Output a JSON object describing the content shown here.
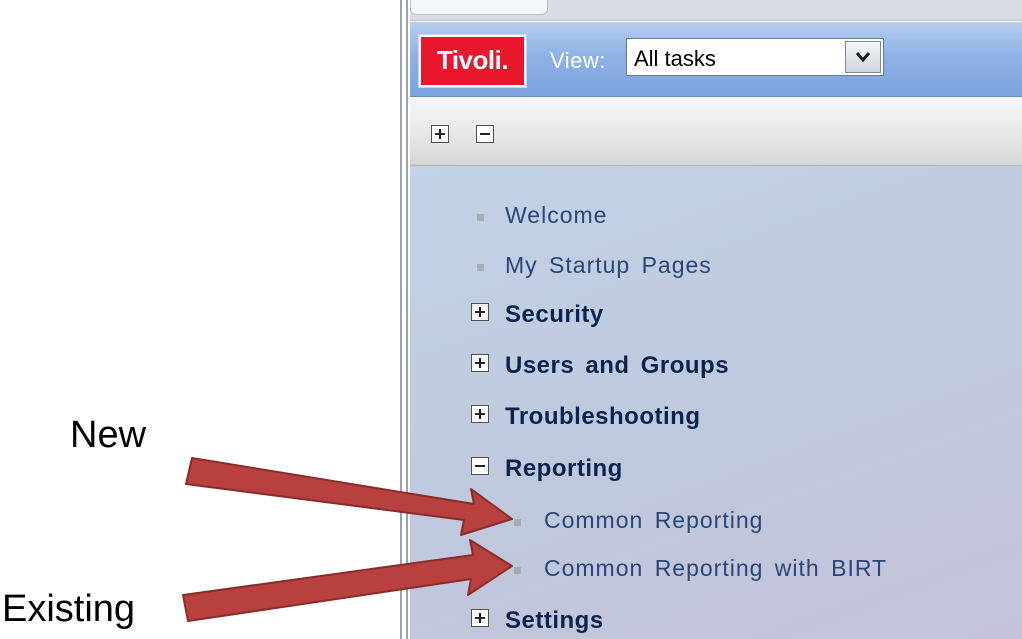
{
  "header": {
    "logo_text": "Tivoli.",
    "view_label": "View:",
    "view_value": "All tasks"
  },
  "toolbar": {
    "expand_all": "expand-all",
    "collapse_all": "collapse-all"
  },
  "nav": {
    "items": [
      {
        "label": "Welcome",
        "type": "link"
      },
      {
        "label": "My Startup Pages",
        "type": "link"
      },
      {
        "label": "Security",
        "type": "group",
        "state": "collapsed"
      },
      {
        "label": "Users and Groups",
        "type": "group",
        "state": "collapsed"
      },
      {
        "label": "Troubleshooting",
        "type": "group",
        "state": "collapsed"
      },
      {
        "label": "Reporting",
        "type": "group",
        "state": "expanded"
      },
      {
        "label": "Common Reporting",
        "type": "link"
      },
      {
        "label": "Common Reporting with BIRT",
        "type": "link"
      },
      {
        "label": "Settings",
        "type": "group",
        "state": "collapsed"
      }
    ]
  },
  "annotations": {
    "new_label": "New",
    "existing_label": "Existing"
  },
  "colors": {
    "logo_red": "#e8172b",
    "header_blue": "#8fb2e6",
    "link_text": "#294679",
    "group_text": "#0b2350",
    "arrow_fill": "#b8403e",
    "arrow_stroke": "#8a2c2a"
  }
}
